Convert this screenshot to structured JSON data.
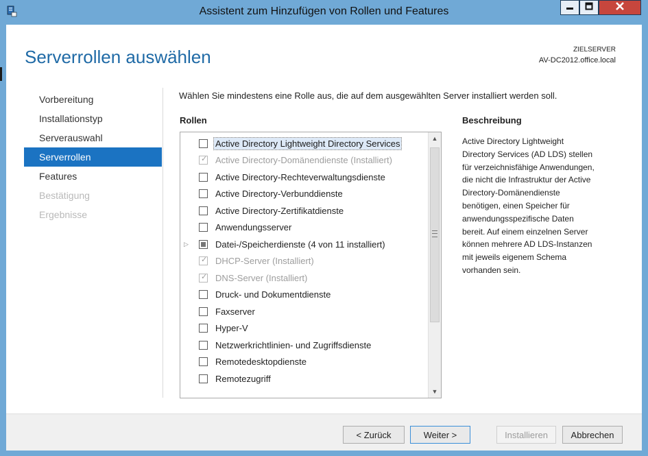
{
  "window": {
    "title": "Assistent zum Hinzufügen von Rollen und Features"
  },
  "header": {
    "title": "Serverrollen auswählen",
    "target_label": "ZIELSERVER",
    "target_value": "AV-DC2012.office.local"
  },
  "nav": {
    "items": [
      {
        "label": "Vorbereitung"
      },
      {
        "label": "Installationstyp"
      },
      {
        "label": "Serverauswahl"
      },
      {
        "label": "Serverrollen"
      },
      {
        "label": "Features"
      },
      {
        "label": "Bestätigung"
      },
      {
        "label": "Ergebnisse"
      }
    ]
  },
  "main": {
    "instruction": "Wählen Sie mindestens eine Rolle aus, die auf dem ausgewählten Server installiert werden soll.",
    "roles_heading": "Rollen",
    "roles": [
      {
        "label": "Active Directory Lightweight Directory Services",
        "checked": false
      },
      {
        "label": "Active Directory-Domänendienste (Installiert)",
        "checked": true
      },
      {
        "label": "Active Directory-Rechteverwaltungsdienste",
        "checked": false
      },
      {
        "label": "Active Directory-Verbunddienste",
        "checked": false
      },
      {
        "label": "Active Directory-Zertifikatdienste",
        "checked": false
      },
      {
        "label": "Anwendungsserver",
        "checked": false
      },
      {
        "label": "Datei-/Speicherdienste (4 von 11 installiert)",
        "checked": "partial"
      },
      {
        "label": "DHCP-Server (Installiert)",
        "checked": true
      },
      {
        "label": "DNS-Server (Installiert)",
        "checked": true
      },
      {
        "label": "Druck- und Dokumentdienste",
        "checked": false
      },
      {
        "label": "Faxserver",
        "checked": false
      },
      {
        "label": "Hyper-V",
        "checked": false
      },
      {
        "label": "Netzwerkrichtlinien- und Zugriffsdienste",
        "checked": false
      },
      {
        "label": "Remotedesktopdienste",
        "checked": false
      },
      {
        "label": "Remotezugriff",
        "checked": false
      }
    ],
    "description_heading": "Beschreibung",
    "description_lines": [
      "Active Directory Lightweight",
      "Directory Services (AD LDS) stellen",
      "für verzeichnisfähige Anwendungen,",
      "die nicht die Infrastruktur der Active",
      "Directory-Domänendienste",
      "benötigen, einen Speicher für",
      "anwendungsspezifische Daten",
      "bereit. Auf einem einzelnen Server",
      "können mehrere AD LDS-Instanzen",
      "mit jeweils eigenem Schema",
      "vorhanden sein."
    ]
  },
  "footer": {
    "back_label": "< Zurück",
    "next_label": "Weiter >",
    "install_label": "Installieren",
    "cancel_label": "Abbrechen"
  },
  "colors": {
    "frame": "#70a9d6",
    "accent": "#1b73c2",
    "heading": "#1f6aa6",
    "close": "#c7463d"
  },
  "icons": {
    "app": "server-manager-icon",
    "minimize": "minimize-icon",
    "maximize": "maximize-icon",
    "close": "close-icon",
    "expand": "chevron-right-icon",
    "scroll_up": "chevron-up-icon",
    "scroll_down": "chevron-down-icon"
  }
}
